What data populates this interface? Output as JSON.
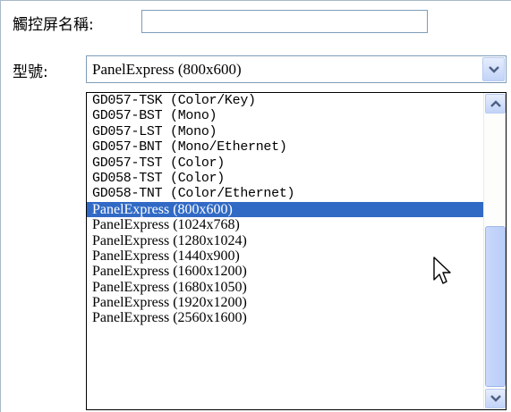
{
  "form": {
    "name_label": "觸控屏名稱:",
    "name_value": "",
    "model_label": "型號:",
    "model_selected": "PanelExpress (800x600)"
  },
  "dropdown": {
    "items": [
      {
        "label": "GD057-TSK (Color/Key)",
        "selected": false
      },
      {
        "label": "GD057-BST (Mono)",
        "selected": false
      },
      {
        "label": "GD057-LST (Mono)",
        "selected": false
      },
      {
        "label": "GD057-BNT (Mono/Ethernet)",
        "selected": false
      },
      {
        "label": "GD057-TST (Color)",
        "selected": false
      },
      {
        "label": "GD058-TST (Color)",
        "selected": false
      },
      {
        "label": "GD058-TNT (Color/Ethernet)",
        "selected": false
      },
      {
        "label": "PanelExpress (800x600)",
        "selected": true
      },
      {
        "label": "PanelExpress (1024x768)",
        "selected": false
      },
      {
        "label": "PanelExpress (1280x1024)",
        "selected": false
      },
      {
        "label": "PanelExpress (1440x900)",
        "selected": false
      },
      {
        "label": "PanelExpress (1600x1200)",
        "selected": false
      },
      {
        "label": "PanelExpress (1680x1050)",
        "selected": false
      },
      {
        "label": "PanelExpress (1920x1200)",
        "selected": false
      },
      {
        "label": "PanelExpress (2560x1600)",
        "selected": false
      }
    ]
  },
  "colors": {
    "selection": "#316ac5",
    "border": "#7f9db9"
  }
}
